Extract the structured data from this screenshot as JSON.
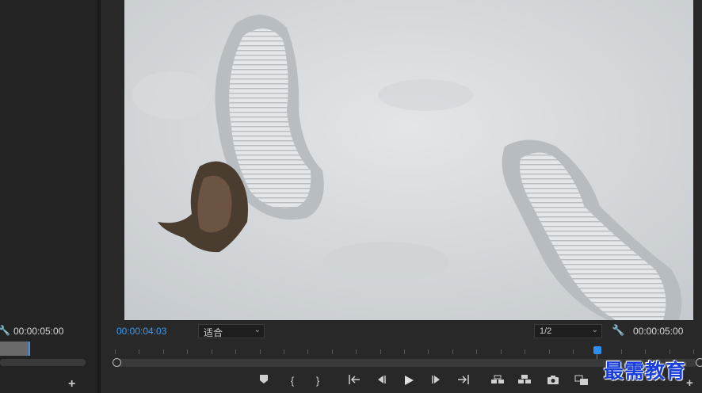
{
  "left_panel": {
    "timecode": "00:00:05:00"
  },
  "program_monitor": {
    "current_timecode": "00:00:04:03",
    "fit_select": "适合",
    "resolution_select": "1/2",
    "duration_timecode": "00:00:05:00",
    "playhead_position_fraction": 0.83
  },
  "controls": [
    {
      "name": "add-marker-button",
      "glyph": "⬟"
    },
    {
      "name": "mark-in-button",
      "glyph": "{"
    },
    {
      "name": "mark-out-button",
      "glyph": "}"
    },
    {
      "name": "go-to-in-button",
      "glyph": "{←"
    },
    {
      "name": "step-back-button",
      "glyph": "◀|"
    },
    {
      "name": "play-button",
      "glyph": "▶"
    },
    {
      "name": "step-forward-button",
      "glyph": "|▶"
    },
    {
      "name": "go-to-out-button",
      "glyph": "→}"
    },
    {
      "name": "lift-button",
      "glyph": "lift"
    },
    {
      "name": "extract-button",
      "glyph": "extract"
    },
    {
      "name": "export-frame-button",
      "glyph": "camera"
    },
    {
      "name": "comparison-view-button",
      "glyph": "compare"
    }
  ],
  "watermark": "最需教育",
  "colors": {
    "accent_blue": "#2e8ff0",
    "timecode_blue": "#3a9cf0",
    "watermark_blue": "#1a3fd8"
  }
}
